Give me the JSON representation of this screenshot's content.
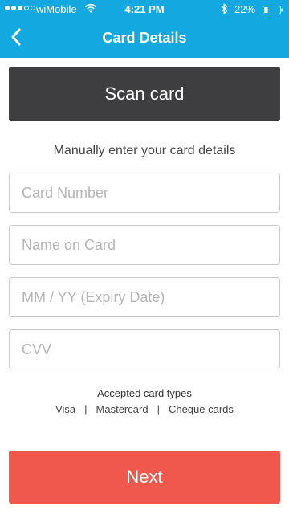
{
  "colors": {
    "header_bg": "#13a8df",
    "scan_button_bg": "#3e3e40",
    "next_button_bg": "#f0584c",
    "field_border": "#c9c9c9",
    "placeholder": "#b5b5b5"
  },
  "status_bar": {
    "carrier": "wiMobile",
    "time": "4:21 PM",
    "battery": "22%",
    "signal_bars_filled": 3,
    "signal_bars_total": 5,
    "icons": [
      "wifi-icon",
      "bluetooth-icon",
      "battery-icon"
    ]
  },
  "nav": {
    "title": "Card Details",
    "back_icon": "chevron-left-icon"
  },
  "scan": {
    "label": "Scan card"
  },
  "instructions": "Manually enter your card details",
  "form": {
    "card_number": {
      "placeholder": "Card Number",
      "value": ""
    },
    "name_on_card": {
      "placeholder": "Name on Card",
      "value": ""
    },
    "expiry": {
      "placeholder": "MM / YY (Expiry Date)",
      "value": ""
    },
    "cvv": {
      "placeholder": "CVV",
      "value": ""
    }
  },
  "accepted": {
    "title": "Accepted card types",
    "types": [
      "Visa",
      "Mastercard",
      "Cheque cards"
    ],
    "separator": "|"
  },
  "next": {
    "label": "Next"
  }
}
